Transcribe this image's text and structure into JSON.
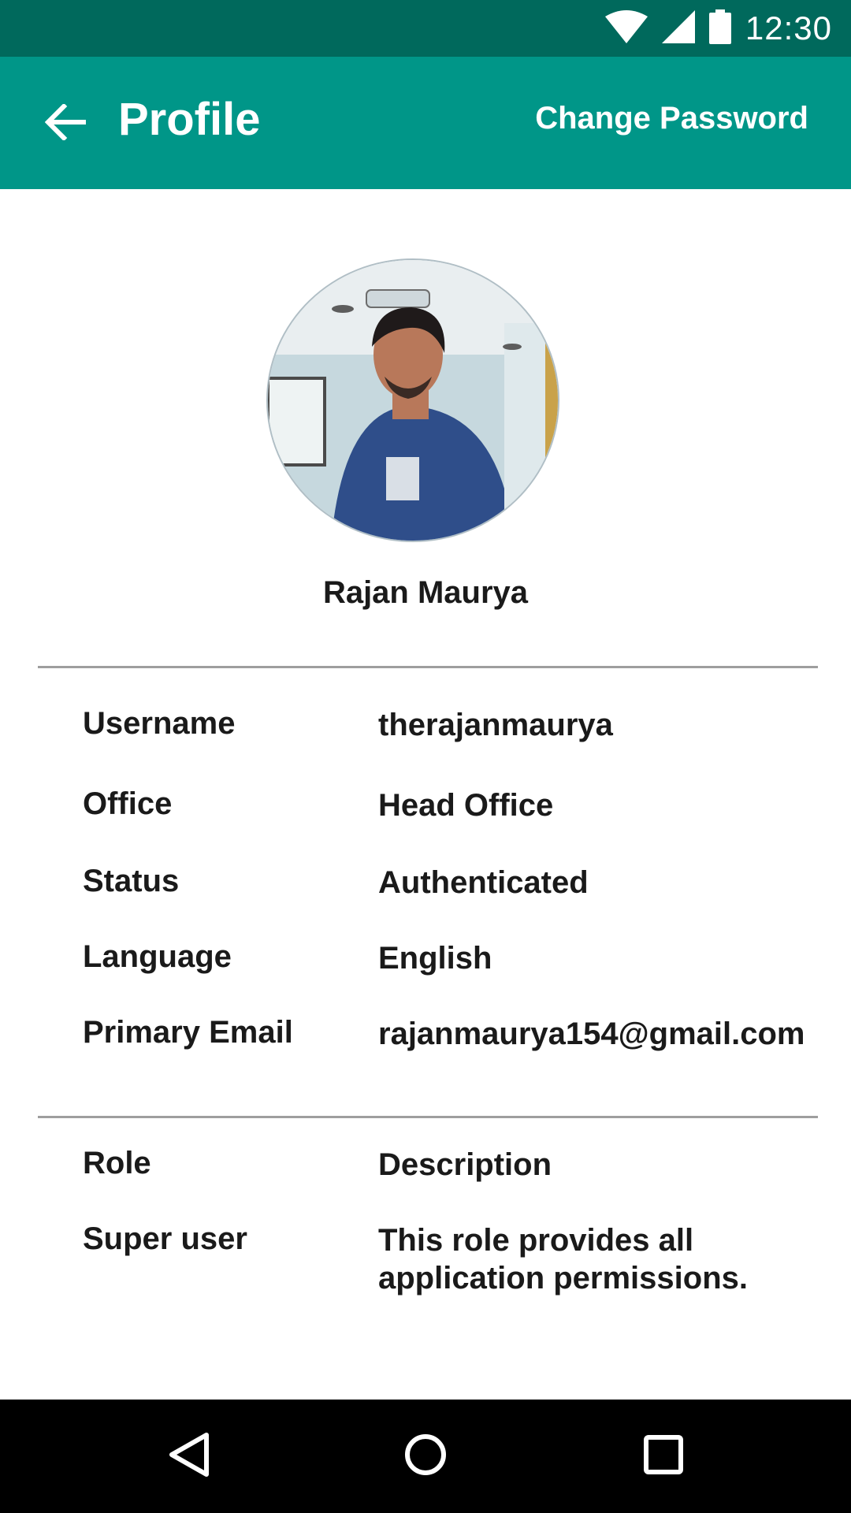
{
  "status_bar": {
    "time": "12:30",
    "icons": [
      "wifi-icon",
      "signal-icon",
      "battery-icon"
    ]
  },
  "app_bar": {
    "title": "Profile",
    "action_label": "Change Password",
    "back_icon": "arrow-back-icon"
  },
  "profile": {
    "name": "Rajan Maurya",
    "details": [
      {
        "label": "Username",
        "value": "therajanmaurya"
      },
      {
        "label": "Office",
        "value": "Head Office"
      },
      {
        "label": "Status",
        "value": "Authenticated"
      },
      {
        "label": "Language",
        "value": "English"
      },
      {
        "label": "Primary Email",
        "value": "rajanmaurya154@gmail.com"
      }
    ]
  },
  "roles": {
    "header_label": "Role",
    "header_value": "Description",
    "items": [
      {
        "role": "Super user",
        "description": "This role provides all application permissions."
      }
    ]
  },
  "navigation": {
    "icons": [
      "back-triangle-icon",
      "home-circle-icon",
      "recents-square-icon"
    ]
  },
  "colors": {
    "status_bar": "#00695c",
    "app_bar": "#009688",
    "nav_bar": "#000000",
    "divider": "#9e9e9e"
  }
}
